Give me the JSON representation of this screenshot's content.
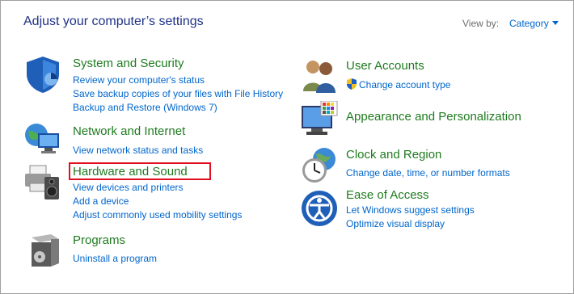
{
  "header": {
    "title": "Adjust your computer’s settings",
    "view_by_label": "View by:",
    "view_by_value": "Category"
  },
  "left": [
    {
      "title": "System and Security",
      "icon": "shield-icon",
      "links": [
        "Review your computer's status",
        "Save backup copies of your files with File History",
        "Backup and Restore (Windows 7)"
      ]
    },
    {
      "title": "Network and Internet",
      "icon": "network-globe-icon",
      "links": [
        "View network status and tasks"
      ]
    },
    {
      "title": "Hardware and Sound",
      "icon": "printer-speaker-icon",
      "links": [
        "View devices and printers",
        "Add a device",
        "Adjust commonly used mobility settings"
      ]
    },
    {
      "title": "Programs",
      "icon": "programs-box-icon",
      "links": [
        "Uninstall a program"
      ]
    }
  ],
  "right": [
    {
      "title": "User Accounts",
      "icon": "users-icon",
      "links": [
        "Change account type"
      ]
    },
    {
      "title": "Appearance and Personalization",
      "icon": "monitor-palette-icon",
      "links": []
    },
    {
      "title": "Clock and Region",
      "icon": "clock-globe-icon",
      "links": [
        "Change date, time, or number formats"
      ]
    },
    {
      "title": "Ease of Access",
      "icon": "ease-of-access-icon",
      "links": [
        "Let Windows suggest settings",
        "Optimize visual display"
      ]
    }
  ],
  "colors": {
    "heading_green": "#1e7b1e",
    "link_blue": "#0066cc",
    "title_blue": "#1e3287",
    "highlight_red": "#e01020"
  }
}
